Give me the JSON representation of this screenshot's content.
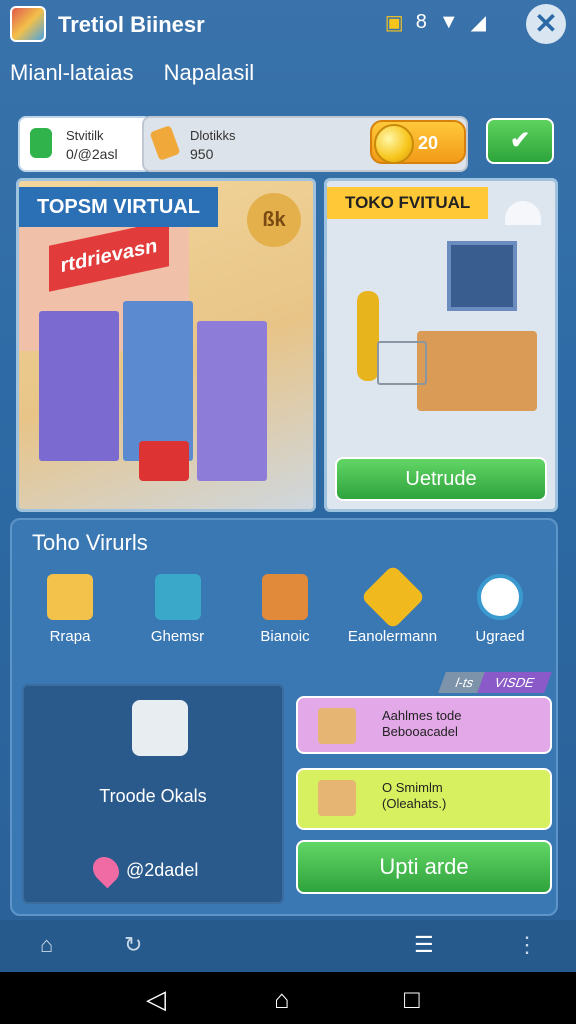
{
  "header": {
    "app_title": "Tretiol Biinesr",
    "close_label": "✕",
    "status_icons": [
      "8",
      "▼",
      "◢"
    ]
  },
  "subtitle": {
    "left": "Mianl-lataias",
    "right": "Napalasil"
  },
  "resources": {
    "card1_label": "Stvitilk",
    "card1_value": "0/@2asl",
    "card2_label": "Dlotikks",
    "card2_value": "950",
    "coins": "20",
    "confirm_label": "✔"
  },
  "scenes": {
    "left_title": "TOPSM VIRTUAL",
    "left_sign": "rtdrievasn",
    "left_badge": "ßk",
    "right_title": "TOKO FVITUAL",
    "right_button": "Uetrude"
  },
  "panel": {
    "title": "Toho Virurls",
    "tools": [
      {
        "label": "Rrapa",
        "icon": "box-hammer-icon"
      },
      {
        "label": "Ghemsr",
        "icon": "cube-icon"
      },
      {
        "label": "Bianoic",
        "icon": "crates-icon"
      },
      {
        "label": "Eanolermann",
        "icon": "hexagon-icon"
      },
      {
        "label": "Ugraed",
        "icon": "clock-icon"
      }
    ],
    "machine_label": "Troode Okals",
    "location_value": "@2dadel",
    "tag_gray": "l-ts",
    "tag_purple": "VISDE",
    "offer1_line1": "Aahlmes tode",
    "offer1_line2": "Bebooacadel",
    "offer2_line1": "O Smimlm",
    "offer2_line2": "(Oleahats.)",
    "upgrade_label": "Upti arde"
  }
}
